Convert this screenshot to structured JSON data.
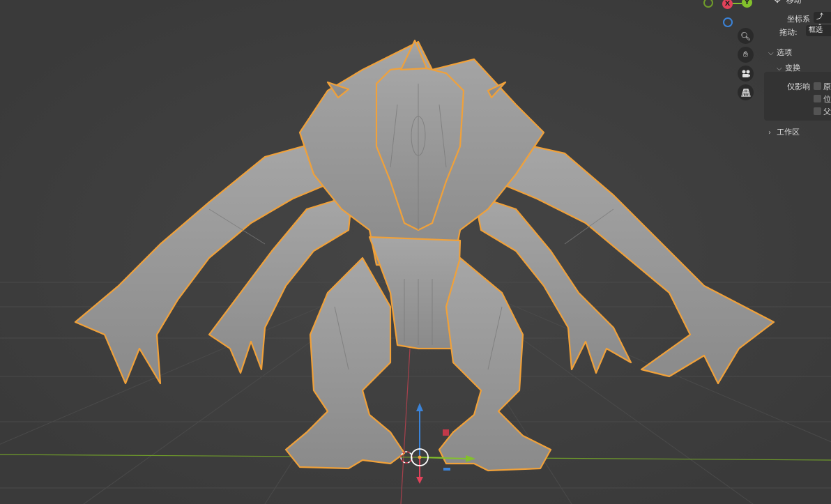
{
  "viewport": {
    "background": "#3d3d3d",
    "selection_outline_color": "#f0a13a",
    "x_axis_color": "#e2425a",
    "y_axis_color": "#83c12c",
    "z_axis_color": "#3b83d8"
  },
  "gizmo": {
    "x_label": "X",
    "y_label": "Y",
    "nav_buttons": [
      {
        "icon": "zoom-icon",
        "glyph": "⊕"
      },
      {
        "icon": "hand-pan-icon",
        "glyph": "✋"
      },
      {
        "icon": "camera-icon",
        "glyph": "▣"
      },
      {
        "icon": "perspective-grid-icon",
        "glyph": "▦"
      }
    ]
  },
  "tool_panel": {
    "tool_name": "移动",
    "orientation_label": "坐标系",
    "orientation_value": "⤴ 全",
    "drag_label": "拖动:",
    "drag_value": "框选",
    "options_label": "选项",
    "transform_label": "变换",
    "affect_only_label": "仅影响",
    "affect_options": [
      "原",
      "位",
      "父"
    ],
    "workspace_label": "工作区"
  }
}
